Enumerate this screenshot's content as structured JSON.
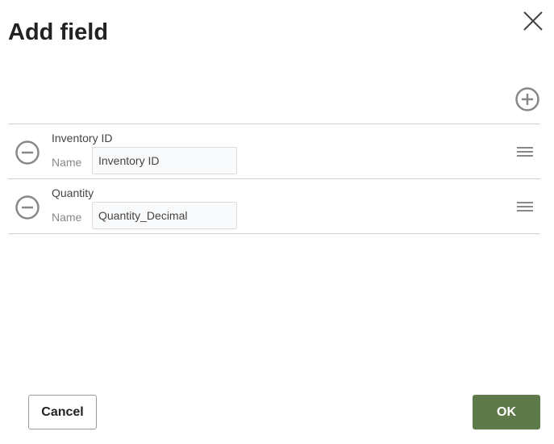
{
  "dialog": {
    "title": "Add field"
  },
  "icons": {
    "close": "close-icon",
    "add": "plus-circle-icon",
    "remove": "minus-circle-icon",
    "drag": "drag-handle-icon"
  },
  "fields": [
    {
      "label": "Inventory ID",
      "name_label": "Name",
      "name_value": "Inventory ID"
    },
    {
      "label": "Quantity",
      "name_label": "Name",
      "name_value": "Quantity_Decimal"
    }
  ],
  "buttons": {
    "cancel": "Cancel",
    "ok": "OK"
  },
  "colors": {
    "ok_button": "#5f7a4a",
    "icon_gray": "#888888",
    "divider": "#d0d0d0"
  }
}
